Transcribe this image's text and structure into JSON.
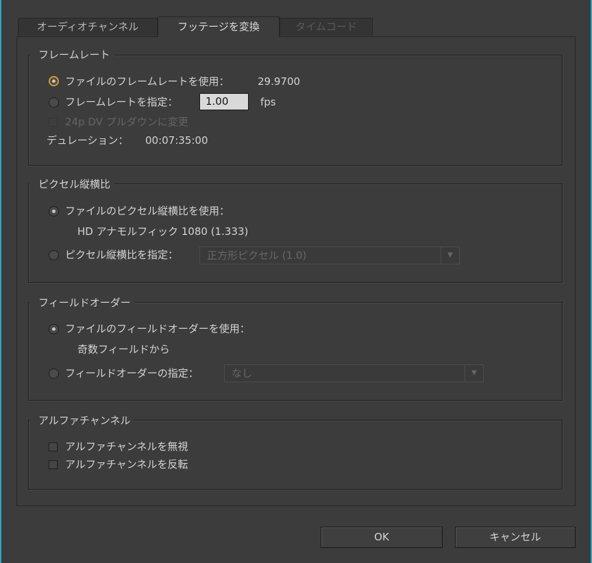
{
  "tabs": [
    {
      "label": "オーディオチャンネル",
      "state": "normal"
    },
    {
      "label": "フッテージを変換",
      "state": "active"
    },
    {
      "label": "タイムコード",
      "state": "disabled"
    }
  ],
  "frame_rate": {
    "title": "フレームレート",
    "use_file_label": "ファイルのフレームレートを使用：",
    "file_value": "29.9700",
    "specify_label": "フレームレートを指定：",
    "specify_value": "1.00",
    "unit": "fps",
    "pulldown_label": "24p DV プルダウンに変更",
    "duration_label": "デュレーション：",
    "duration_value": "00:07:35:00"
  },
  "pixel_aspect": {
    "title": "ピクセル縦横比",
    "use_file_label": "ファイルのピクセル縦横比を使用：",
    "file_value": "HD アナモルフィック 1080 (1.333)",
    "specify_label": "ピクセル縦横比を指定：",
    "select_value": "正方形ピクセル (1.0)"
  },
  "field_order": {
    "title": "フィールドオーダー",
    "use_file_label": "ファイルのフィールドオーダーを使用：",
    "file_value": "奇数フィールドから",
    "specify_label": "フィールドオーダーの指定：",
    "select_value": "なし"
  },
  "alpha": {
    "title": "アルファチャンネル",
    "ignore_label": "アルファチャンネルを無視",
    "invert_label": "アルファチャンネルを反転"
  },
  "buttons": {
    "ok": "OK",
    "cancel": "キャンセル"
  },
  "colors": {
    "accent": "#2aa7c9",
    "focus_ring": "#d89a2a",
    "background": "#3c3c3c"
  }
}
